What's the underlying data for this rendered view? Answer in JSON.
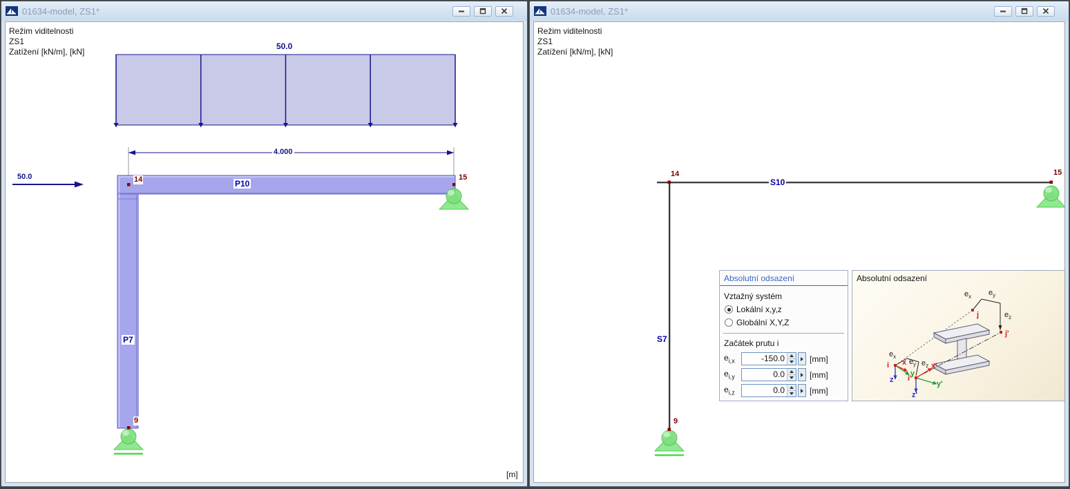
{
  "left_window": {
    "title": "01634-model, ZS1*",
    "info_lines": [
      "Režim viditelnosti",
      "ZS1",
      "Zatížení [kN/m], [kN]"
    ],
    "load_label": "50.0",
    "dimension_label": "4.000",
    "force_label": "50.0",
    "beam_label": "P10",
    "column_label": "P7",
    "node_top_left": "14",
    "node_top_right": "15",
    "node_bottom": "9",
    "unit_label": "[m]"
  },
  "right_window": {
    "title": "01634-model, ZS1*",
    "info_lines": [
      "Režim viditelnosti",
      "ZS1",
      "Zatížení [kN/m], [kN]"
    ],
    "beam_label": "S10",
    "column_label": "S7",
    "node_top_left": "14",
    "node_top_right": "15",
    "node_bottom": "9",
    "offset_panel": {
      "title": "Absolutní odsazení",
      "reference_system_label": "Vztažný systém",
      "radio_options": [
        {
          "label": "Lokální x,y,z",
          "selected": true
        },
        {
          "label": "Globální X,Y,Z",
          "selected": false
        }
      ],
      "member_start_label": "Začátek prutu i",
      "fields": [
        {
          "base": "e",
          "sub": "i,x",
          "value": "-150.0",
          "unit": "[mm]"
        },
        {
          "base": "e",
          "sub": "i,y",
          "value": "0.0",
          "unit": "[mm]"
        },
        {
          "base": "e",
          "sub": "i,z",
          "value": "0.0",
          "unit": "[mm]"
        }
      ]
    },
    "graphic_panel": {
      "title": "Absolutní odsazení",
      "point_labels": {
        "i": "i",
        "j": "j",
        "i_prime": "i'",
        "j_prime": "j'"
      },
      "offset_labels": {
        "base": "e",
        "x": "x",
        "y": "y",
        "z": "z"
      },
      "axis_labels": {
        "x": "x",
        "y": "y",
        "z": "z",
        "x_prime": "x'",
        "y_prime": "y'",
        "z_prime": "z'"
      }
    }
  },
  "colors": {
    "load_navy": "#16168c",
    "member_fill": "#a6a6ec",
    "node_red": "#7a0000",
    "support_green": "#7ddf7d",
    "panel_header_blue": "#3a64c4"
  }
}
